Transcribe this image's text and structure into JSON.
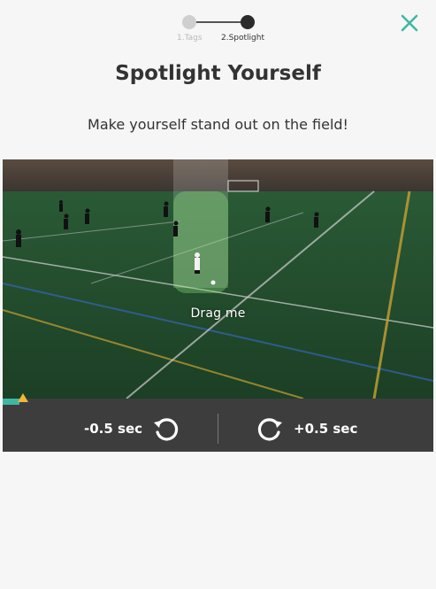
{
  "stepper": {
    "steps": [
      {
        "label": "1.Tags"
      },
      {
        "label": "2.Spotlight"
      }
    ]
  },
  "header": {
    "title": "Spotlight Yourself",
    "subtitle": "Make yourself stand out on the field!"
  },
  "video": {
    "drag_label": "Drag me",
    "progress": 0.04
  },
  "controls": {
    "back_label": "-0.5 sec",
    "forward_label": "+0.5 sec"
  },
  "colors": {
    "accent": "#3fb8a2",
    "marker": "#f0b73a",
    "bar": "#3d3d3d"
  },
  "icons": {
    "close": "close-icon",
    "back": "rotate-ccw-icon",
    "forward": "rotate-cw-icon"
  }
}
